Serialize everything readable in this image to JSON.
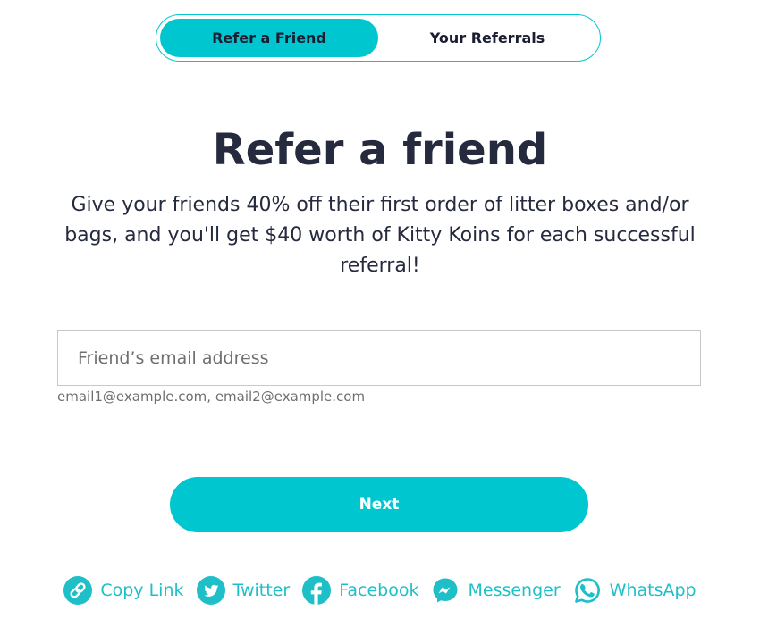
{
  "tabs": {
    "active": "Refer a Friend",
    "inactive": "Your Referrals"
  },
  "heading": "Refer a friend",
  "description": "Give your friends 40% off their first order of litter boxes and/or bags, and you'll get $40 worth of Kitty Koins for each successful referral!",
  "email": {
    "placeholder": "Friend’s email address",
    "hint": "email1@example.com, email2@example.com"
  },
  "next_label": "Next",
  "share": [
    {
      "label": "Copy Link",
      "icon": "link-icon"
    },
    {
      "label": "Twitter",
      "icon": "twitter-icon"
    },
    {
      "label": "Facebook",
      "icon": "facebook-icon"
    },
    {
      "label": "Messenger",
      "icon": "messenger-icon"
    },
    {
      "label": "WhatsApp",
      "icon": "whatsapp-icon"
    }
  ],
  "colors": {
    "accent": "#00c7cf",
    "text": "#262a3e",
    "muted": "#6f6f6f",
    "share_text": "#1fbfc8"
  }
}
